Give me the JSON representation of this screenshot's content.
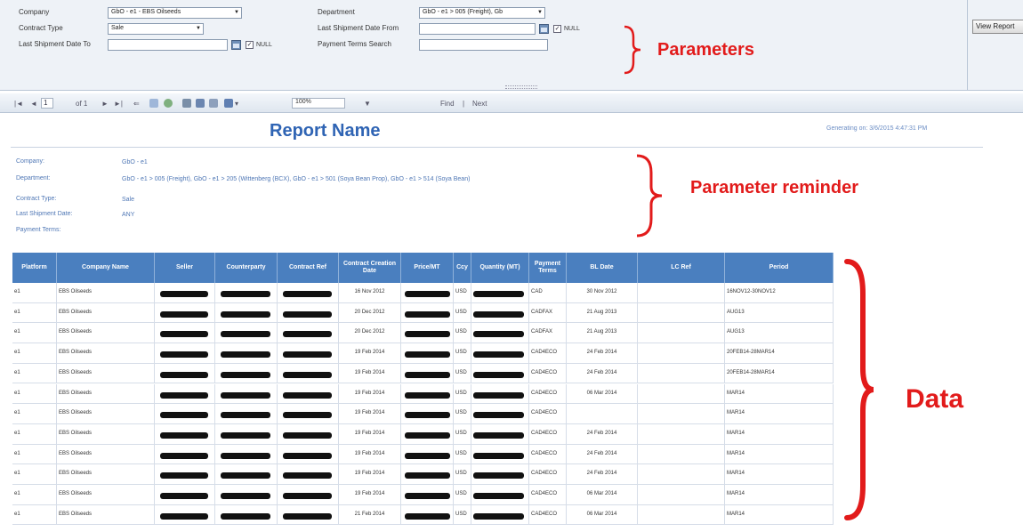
{
  "params": {
    "company_label": "Company",
    "company_value": "GbO - e1 - EBS Oilseeds",
    "contract_type_label": "Contract Type",
    "contract_type_value": "Sale",
    "last_ship_to_label": "Last Shipment Date To",
    "department_label": "Department",
    "department_value": "GbO - e1 > 005 (Freight), Gb",
    "last_ship_from_label": "Last Shipment Date From",
    "payment_terms_label": "Payment Terms Search",
    "null_label": "NULL",
    "view_report_label": "View Report"
  },
  "toolbar": {
    "page_current": "1",
    "page_of": "of 1",
    "zoom": "100%",
    "find": "Find",
    "next": "Next"
  },
  "report": {
    "title": "Report Name",
    "generated": "Generating on: 3/6/2015 4:47:31 PM"
  },
  "reminder": {
    "rows": [
      {
        "label": "Company:",
        "value": "GbO - e1"
      },
      {
        "label": "Department:",
        "value": "GbO - e1 > 005 (Freight), GbO - e1 > 205 (Wittenberg (BCX), GbO - e1 > 501 (Soya Bean Prop), GbO - e1 > 514 (Soya Bean)"
      },
      {
        "label": "Contract Type:",
        "value": "Sale"
      },
      {
        "label": "Last Shipment Date:",
        "value": "ANY"
      },
      {
        "label": "Payment Terms:",
        "value": ""
      }
    ]
  },
  "annotations": {
    "parameters": "Parameters",
    "reminder": "Parameter reminder",
    "data": "Data"
  },
  "table": {
    "columns": [
      "Platform",
      "Company Name",
      "Seller",
      "Counterparty",
      "Contract Ref",
      "Contract Creation Date",
      "Price/MT",
      "Ccy",
      "Quantity (MT)",
      "Payment Terms",
      "BL Date",
      "LC Ref",
      "Period"
    ],
    "rows": [
      {
        "platform": "e1",
        "company": "EBS Oilseeds",
        "created": "16 Nov 2012",
        "ccy": "USD",
        "terms": "CAD",
        "bl": "30 Nov 2012",
        "period": "16NOV12-30NOV12"
      },
      {
        "platform": "e1",
        "company": "EBS Oilseeds",
        "created": "20 Dec 2012",
        "ccy": "USD",
        "terms": "CADFAX",
        "bl": "21 Aug 2013",
        "period": "AUG13"
      },
      {
        "platform": "e1",
        "company": "EBS Oilseeds",
        "created": "20 Dec 2012",
        "ccy": "USD",
        "terms": "CADFAX",
        "bl": "21 Aug 2013",
        "period": "AUG13"
      },
      {
        "platform": "e1",
        "company": "EBS Oilseeds",
        "created": "19 Feb 2014",
        "ccy": "USD",
        "terms": "CAD4ECO",
        "bl": "24 Feb 2014",
        "period": "20FEB14-28MAR14"
      },
      {
        "platform": "e1",
        "company": "EBS Oilseeds",
        "created": "19 Feb 2014",
        "ccy": "USD",
        "terms": "CAD4ECO",
        "bl": "24 Feb 2014",
        "period": "20FEB14-28MAR14"
      },
      {
        "platform": "e1",
        "company": "EBS Oilseeds",
        "created": "19 Feb 2014",
        "ccy": "USD",
        "terms": "CAD4ECO",
        "bl": "06 Mar 2014",
        "period": "MAR14"
      },
      {
        "platform": "e1",
        "company": "EBS Oilseeds",
        "created": "19 Feb 2014",
        "ccy": "USD",
        "terms": "CAD4ECO",
        "bl": "",
        "period": "MAR14"
      },
      {
        "platform": "e1",
        "company": "EBS Oilseeds",
        "created": "19 Feb 2014",
        "ccy": "USD",
        "terms": "CAD4ECO",
        "bl": "24 Feb 2014",
        "period": "MAR14"
      },
      {
        "platform": "e1",
        "company": "EBS Oilseeds",
        "created": "19 Feb 2014",
        "ccy": "USD",
        "terms": "CAD4ECO",
        "bl": "24 Feb 2014",
        "period": "MAR14"
      },
      {
        "platform": "e1",
        "company": "EBS Oilseeds",
        "created": "19 Feb 2014",
        "ccy": "USD",
        "terms": "CAD4ECO",
        "bl": "24 Feb 2014",
        "period": "MAR14"
      },
      {
        "platform": "e1",
        "company": "EBS Oilseeds",
        "created": "19 Feb 2014",
        "ccy": "USD",
        "terms": "CAD4ECO",
        "bl": "06 Mar 2014",
        "period": "MAR14"
      },
      {
        "platform": "e1",
        "company": "EBS Oilseeds",
        "created": "21 Feb 2014",
        "ccy": "USD",
        "terms": "CAD4ECO",
        "bl": "06 Mar 2014",
        "period": "MAR14"
      }
    ]
  },
  "colors": {
    "accent": "#2f64b4",
    "header_bg": "#4a7fbf",
    "annotation_red": "#e21b1b"
  }
}
